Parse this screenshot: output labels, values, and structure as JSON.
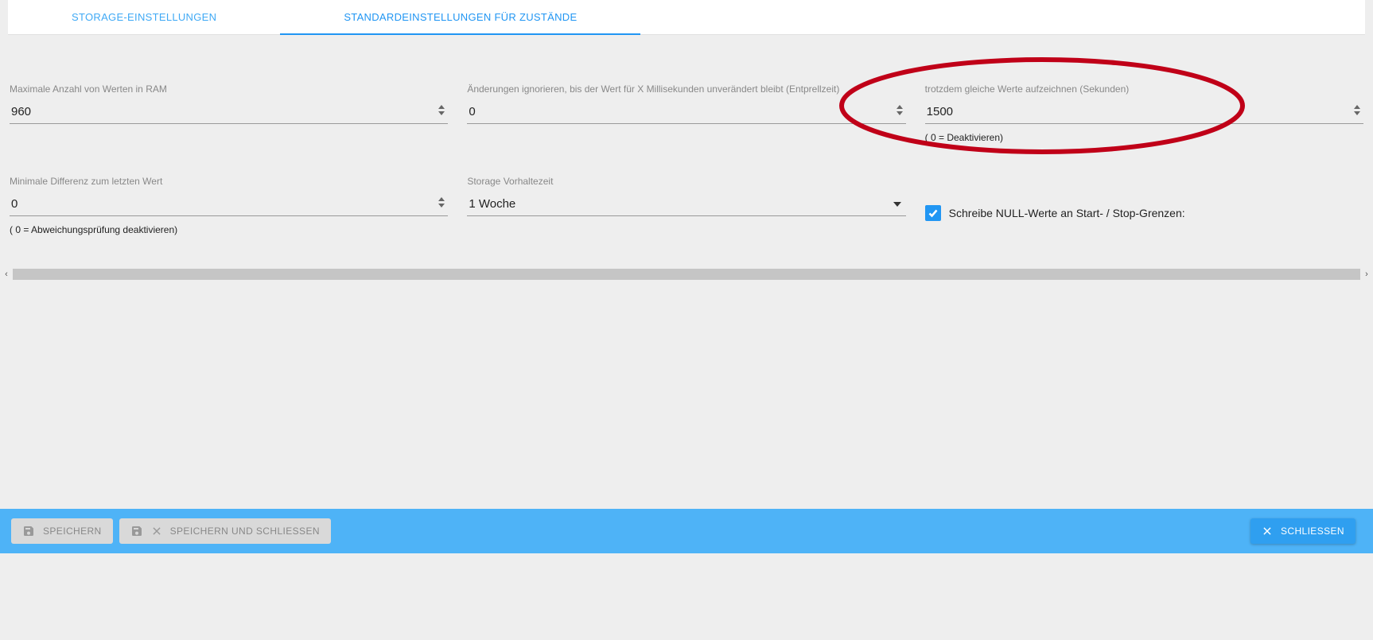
{
  "tabs": {
    "storage": "STORAGE-EINSTELLUNGEN",
    "defaults": "STANDARDEINSTELLUNGEN FÜR ZUSTÄNDE"
  },
  "fields": {
    "maxRam": {
      "label": "Maximale Anzahl von Werten in RAM",
      "value": "960"
    },
    "debounce": {
      "label": "Änderungen ignorieren, bis der Wert für X Millisekunden unverändert bleibt (Entprellzeit)",
      "value": "0"
    },
    "recordSame": {
      "label": "trotzdem gleiche Werte aufzeichnen (Sekunden)",
      "value": "1500",
      "helper": "( 0 = Deaktivieren)"
    },
    "minDiff": {
      "label": "Minimale Differenz zum letzten Wert",
      "value": "0",
      "helper": "( 0 = Abweichungsprüfung deaktivieren)"
    },
    "retention": {
      "label": "Storage Vorhaltezeit",
      "value": "1 Woche"
    },
    "writeNull": {
      "label": "Schreibe NULL-Werte an Start- / Stop-Grenzen:",
      "checked": true
    }
  },
  "buttons": {
    "save": "SPEICHERN",
    "saveClose": "SPEICHERN UND SCHLIESSEN",
    "close": "SCHLIESSEN"
  },
  "colors": {
    "accent": "#2196f3",
    "barBg": "#4eb3f7",
    "annotation": "#c00018"
  }
}
